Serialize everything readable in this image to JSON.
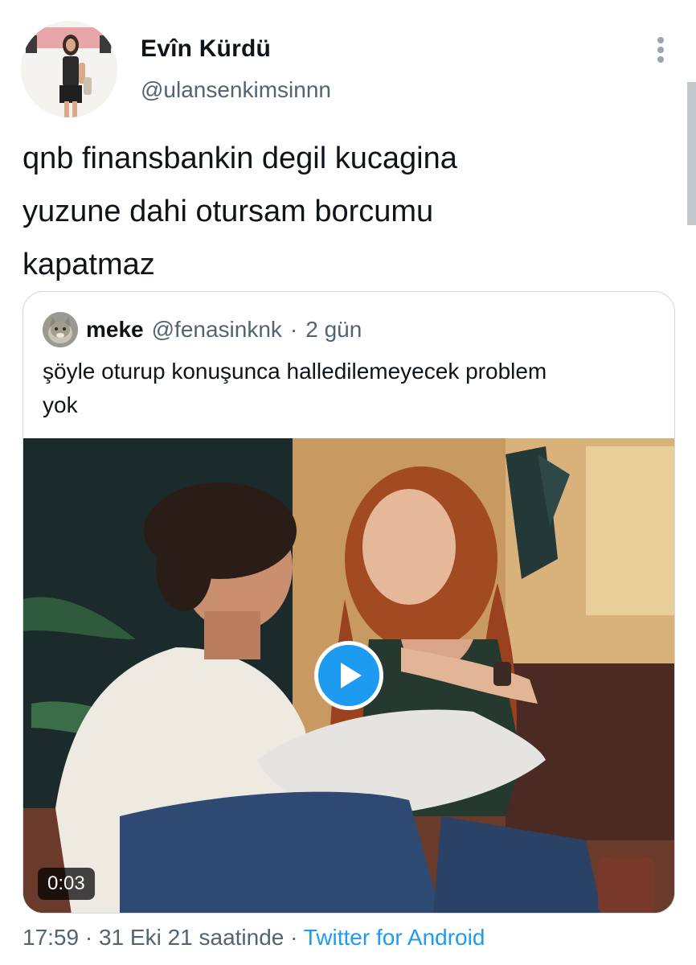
{
  "author": {
    "display_name": "Evîn Kürdü",
    "handle": "@ulansenkimsinnn"
  },
  "tweet": {
    "lines": [
      "qnb finansbankin degil kucagina",
      "yuzune dahi otursam borcumu",
      "kapatmaz"
    ]
  },
  "quoted_tweet": {
    "display_name": "meke",
    "handle": "@fenasinknk",
    "separator": "·",
    "time": "2 gün",
    "text_lines": [
      "şöyle oturup konuşunca halledilemeyecek problem",
      "yok"
    ],
    "video": {
      "duration": "0:03",
      "play_icon": "play-icon"
    }
  },
  "meta": {
    "time": "17:59",
    "separator": "·",
    "date": "31 Eki 21 saatinde",
    "source": "Twitter for Android"
  },
  "icons": {
    "more": "more-vertical-icon",
    "play": "play-icon"
  },
  "colors": {
    "accent": "#1d9bf0",
    "secondary_text": "#536471",
    "primary_text": "#0f1419",
    "border": "#cfd9de"
  }
}
